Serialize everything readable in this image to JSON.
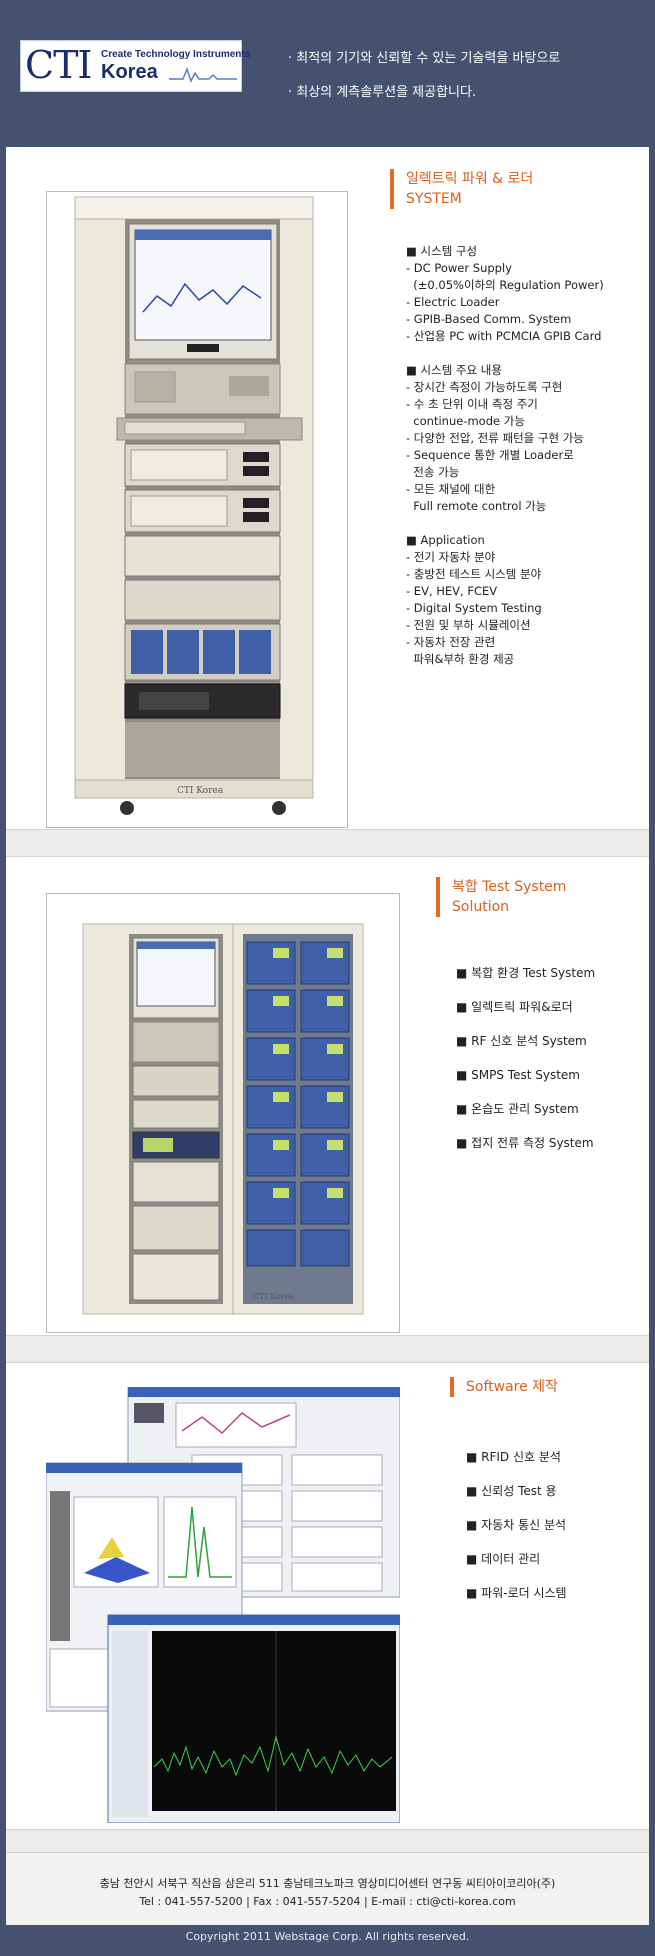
{
  "header": {
    "logo": {
      "cti": "CTI",
      "tagline": "Create Technology Instruments",
      "korea": "Korea"
    },
    "slogans": [
      "· 최적의 기기와 신뢰할 수 있는 기술력을 바탕으로",
      "· 최상의 계측솔루션을 제공합니다."
    ]
  },
  "section1": {
    "title_lines": [
      "일렉트릭 파워 & 로더",
      "SYSTEM"
    ],
    "image_label": "CTI Korea",
    "lines": [
      {
        "text": "시스템 구성",
        "kind": "head"
      },
      {
        "text": "- DC Power Supply",
        "kind": "item"
      },
      {
        "text": "  (±0.05%이하의 Regulation Power)",
        "kind": "item"
      },
      {
        "text": "- Electric Loader",
        "kind": "item"
      },
      {
        "text": "- GPIB-Based Comm. System",
        "kind": "item"
      },
      {
        "text": "- 산업용 PC with PCMCIA GPIB Card",
        "kind": "item"
      },
      {
        "text": "",
        "kind": "gap"
      },
      {
        "text": "시스템 주요 내용",
        "kind": "head"
      },
      {
        "text": "- 장시간 측정이 가능하도록 구현",
        "kind": "item"
      },
      {
        "text": "- 수 초 단위 이내 측정 주기",
        "kind": "item"
      },
      {
        "text": "  continue-mode 가능",
        "kind": "item"
      },
      {
        "text": "- 다양한 전압, 전류 패턴을 구현 가능",
        "kind": "item"
      },
      {
        "text": "- Sequence 통한 개별 Loader로",
        "kind": "item"
      },
      {
        "text": "  전송 가능",
        "kind": "item"
      },
      {
        "text": "- 모든 채널에 대한",
        "kind": "item"
      },
      {
        "text": "  Full remote control 가능",
        "kind": "item"
      },
      {
        "text": "",
        "kind": "gap"
      },
      {
        "text": "Application",
        "kind": "head"
      },
      {
        "text": "- 전기 자동차 분야",
        "kind": "item"
      },
      {
        "text": "- 충방전 테스트 시스템 분야",
        "kind": "item"
      },
      {
        "text": "- EV, HEV, FCEV",
        "kind": "item"
      },
      {
        "text": "- Digital System Testing",
        "kind": "item"
      },
      {
        "text": "- 전원 및 부하 시뮬레이션",
        "kind": "item"
      },
      {
        "text": "- 자동차 전장 관련",
        "kind": "item"
      },
      {
        "text": "  파워&부하 환경 제공",
        "kind": "item"
      }
    ]
  },
  "section2": {
    "title_lines": [
      "복합 Test System",
      "Solution"
    ],
    "image_label": "CTI Korea",
    "bullets": [
      "복합 환경 Test System",
      "일렉트릭 파워&로더",
      "RF 신호 분석 System",
      "SMPS Test System",
      "온습도 관리 System",
      "접지 전류 측정 System"
    ]
  },
  "section3": {
    "title_lines": [
      "Software 제작"
    ],
    "bullets": [
      "RFID 신호 분석",
      "신뢰성 Test 용",
      "자동차 통신 분석",
      "데이터 관리",
      "파워-로더 시스템"
    ]
  },
  "footer": {
    "address": "충남 천안시 서북구 직산읍 삼은리 511 충남테크노파크 영상미디어센터 연구동 씨티아이코리아(주)",
    "contact": "Tel : 041-557-5200 | Fax : 041-557-5204 | E-mail : cti@cti-korea.com",
    "copyright": "Copyright 2011 Webstage Corp. All rights reserved."
  },
  "colors": {
    "header_bg": "#44526f",
    "accent": "#e36a2a",
    "logo_blue": "#1d2c6e"
  }
}
